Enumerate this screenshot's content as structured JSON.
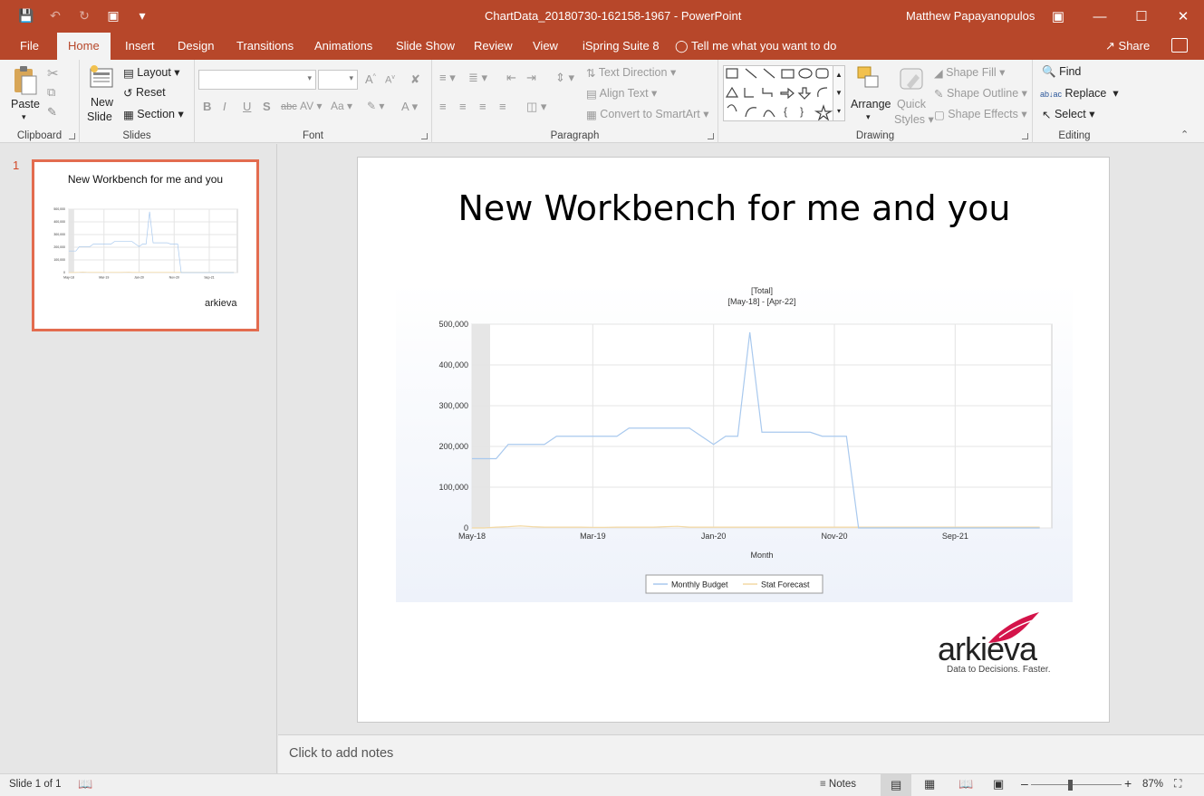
{
  "window": {
    "doc_title": "ChartData_20180730-162158-1967  -  PowerPoint",
    "user": "Matthew Papayanopulos"
  },
  "tabs": [
    "File",
    "Home",
    "Insert",
    "Design",
    "Transitions",
    "Animations",
    "Slide Show",
    "Review",
    "View",
    "iSpring Suite 8"
  ],
  "tell_me": "Tell me what you want to do",
  "share": "Share",
  "ribbon": {
    "clipboard": {
      "label": "Clipboard",
      "paste": "Paste"
    },
    "slides": {
      "label": "Slides",
      "new_slide_1": "New",
      "new_slide_2": "Slide",
      "layout": "Layout",
      "reset": "Reset",
      "section": "Section"
    },
    "font": {
      "label": "Font"
    },
    "paragraph": {
      "label": "Paragraph",
      "text_direction": "Text Direction",
      "align_text": "Align Text",
      "convert_smartart": "Convert to SmartArt"
    },
    "drawing": {
      "label": "Drawing",
      "arrange": "Arrange",
      "quick_1": "Quick",
      "quick_2": "Styles",
      "shape_fill": "Shape Fill",
      "shape_outline": "Shape Outline",
      "shape_effects": "Shape Effects"
    },
    "editing": {
      "label": "Editing",
      "find": "Find",
      "replace": "Replace",
      "select": "Select"
    }
  },
  "thumbnail": {
    "number": "1",
    "title": "New Workbench for me and you",
    "logo": "arkieva"
  },
  "slide": {
    "title": "New Workbench for me and you",
    "logo_word": "arkieva",
    "logo_tag": "Data to Decisions. Faster."
  },
  "chart_data": {
    "type": "line",
    "title": "[Total]",
    "subtitle": "[May-18] - [Apr-22]",
    "xlabel": "Month",
    "ylabel": "",
    "x_tick_labels": [
      "May-18",
      "Mar-19",
      "Jan-20",
      "Nov-20",
      "Sep-21"
    ],
    "y_tick_labels": [
      "0",
      "100,000",
      "200,000",
      "300,000",
      "400,000",
      "500,000"
    ],
    "ylim": [
      0,
      500000
    ],
    "x_months": 48,
    "grid": true,
    "legend_placement": "bottom-center",
    "series": [
      {
        "name": "Monthly Budget",
        "color": "#a9c9ee",
        "values": [
          170000,
          170000,
          170000,
          205000,
          205000,
          205000,
          205000,
          225000,
          225000,
          225000,
          225000,
          225000,
          225000,
          245000,
          245000,
          245000,
          245000,
          245000,
          245000,
          225000,
          205000,
          225000,
          225000,
          480000,
          235000,
          235000,
          235000,
          235000,
          235000,
          225000,
          225000,
          225000,
          0,
          0,
          0,
          0,
          0,
          0,
          0,
          0,
          0,
          0,
          0,
          0,
          0,
          0,
          0,
          0
        ]
      },
      {
        "name": "Stat Forecast",
        "color": "#f3d9a4",
        "values": [
          0,
          0,
          2000,
          3000,
          5000,
          3000,
          2000,
          2000,
          2000,
          2000,
          1500,
          1500,
          2000,
          2000,
          2000,
          2000,
          3000,
          4000,
          2000,
          2000,
          2000,
          2000,
          2000,
          2000,
          2000,
          2000,
          2000,
          2000,
          2000,
          2000,
          2000,
          2000,
          2000,
          2000,
          2000,
          2000,
          2000,
          2000,
          2000,
          2000,
          2000,
          2000,
          2000,
          2000,
          2000,
          2000,
          2000,
          2000
        ]
      }
    ]
  },
  "notes": {
    "placeholder": "Click to add notes"
  },
  "status": {
    "slide_counter": "Slide 1 of 1",
    "notes": "Notes",
    "zoom": "87%"
  }
}
